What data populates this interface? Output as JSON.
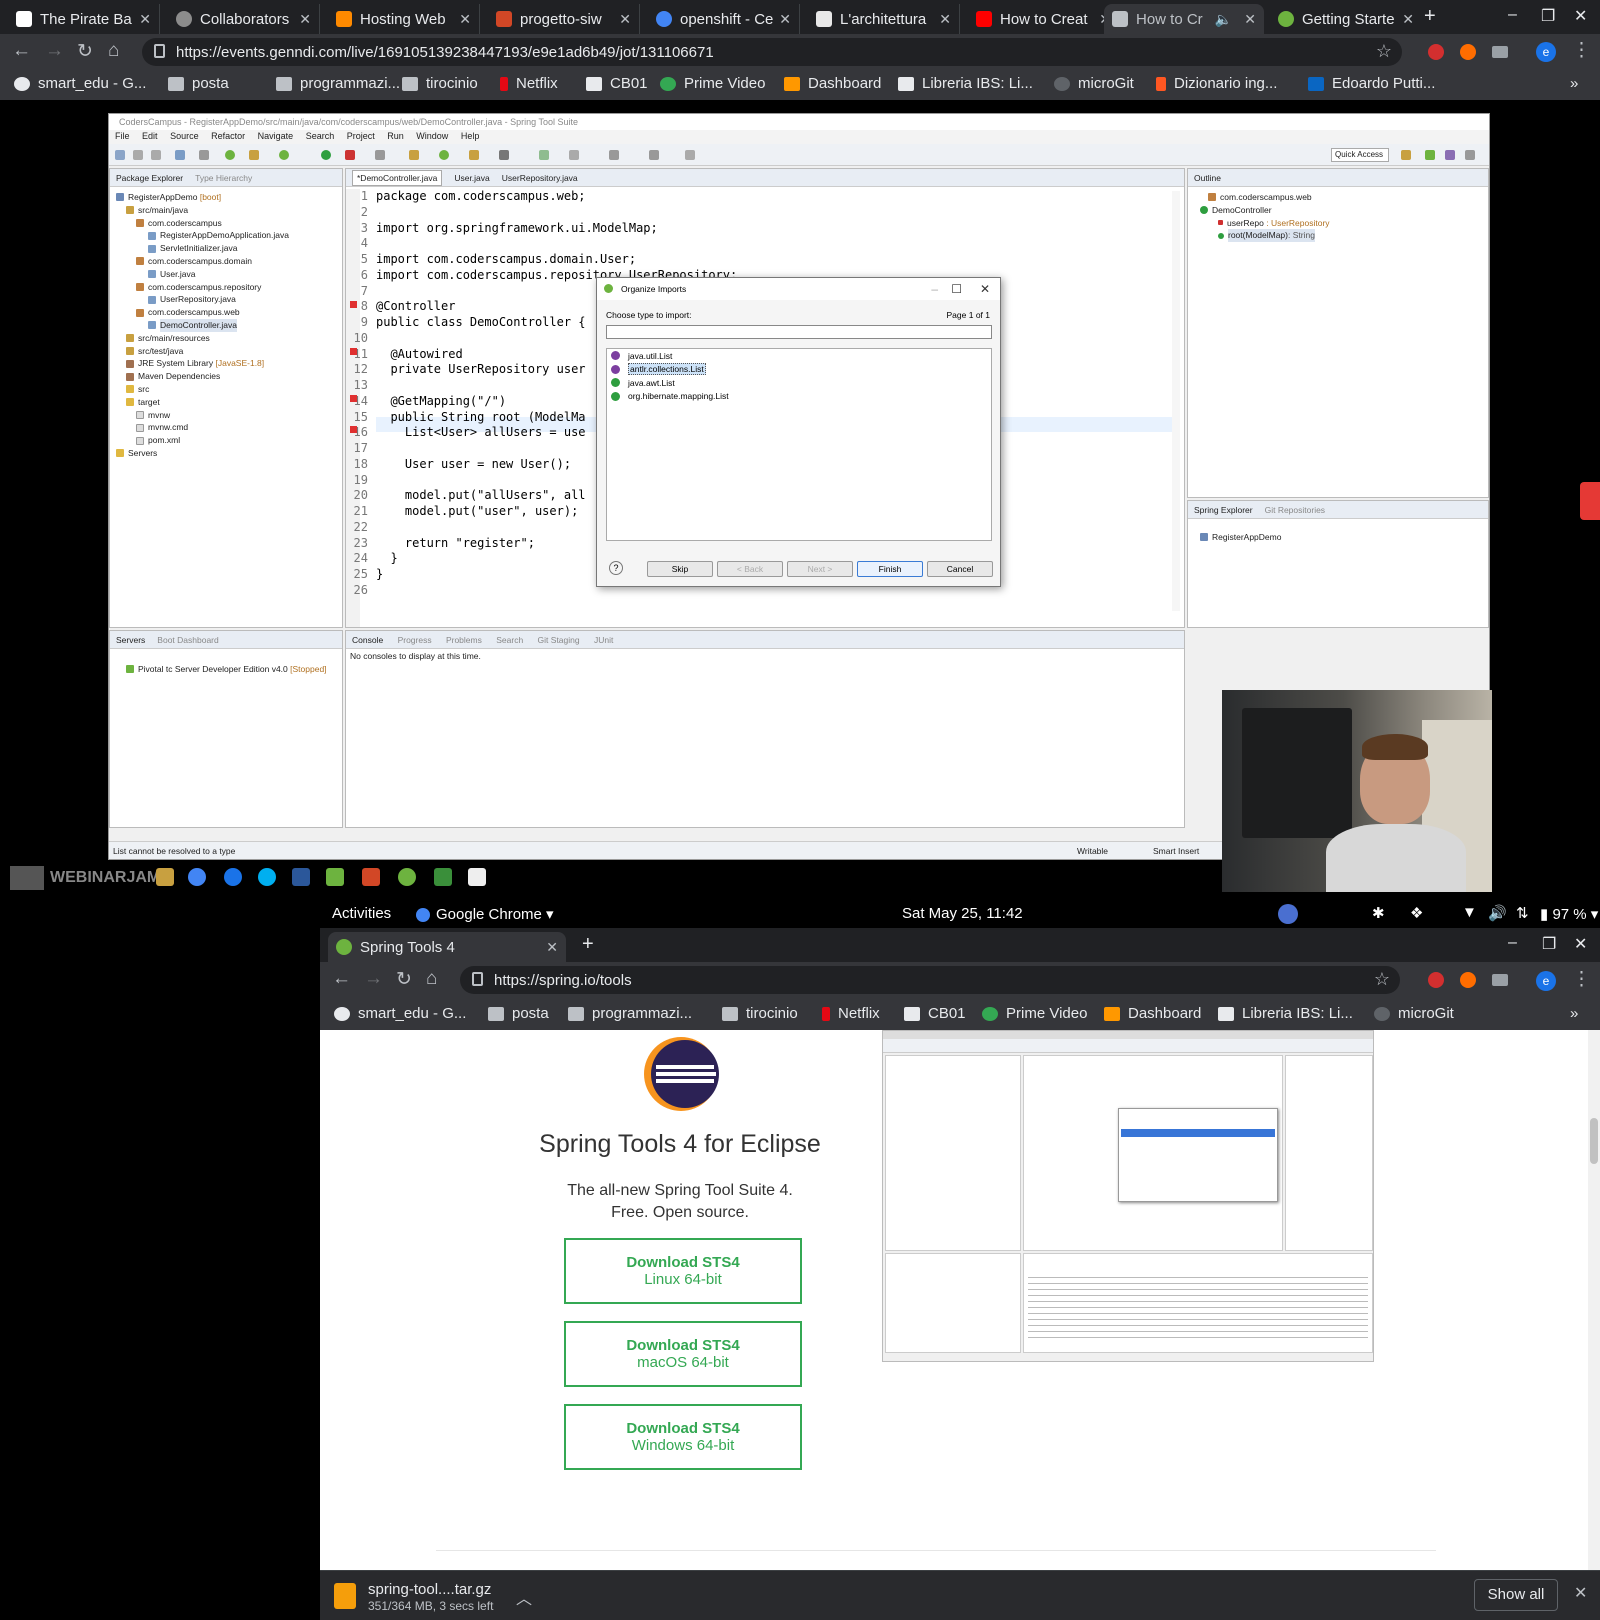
{
  "top_browser": {
    "tabs": [
      {
        "title": "The Pirate Ba",
        "color": "#ffffff"
      },
      {
        "title": "Collaborators",
        "color": "#8c8c8c"
      },
      {
        "title": "Hosting Web",
        "color": "#ff8a00"
      },
      {
        "title": "progetto-siw",
        "color": "#d24726"
      },
      {
        "title": "openshift - Ce",
        "color": "#4285f4"
      },
      {
        "title": "L'architettura",
        "color": "#e8e8e8"
      },
      {
        "title": "How to Creat",
        "color": "#ff0000"
      },
      {
        "title": "How to Cr",
        "color": "#bdc1c6"
      },
      {
        "title": "Getting Starte",
        "color": "#6db33f"
      }
    ],
    "new_tab": "+",
    "url": "https://events.genndi.com/live/169105139238447193/e9e1ad6b49/jot/131106671",
    "avatar_letter": "e"
  },
  "bookmarks": [
    {
      "label": "smart_edu - G...",
      "icon": "github-icon"
    },
    {
      "label": "posta",
      "icon": "folder-icon"
    },
    {
      "label": "programmazi...",
      "icon": "folder-icon"
    },
    {
      "label": "tirocinio",
      "icon": "folder-icon"
    },
    {
      "label": "Netflix",
      "icon": "netflix-icon"
    },
    {
      "label": "CB01",
      "icon": "cb01-icon"
    },
    {
      "label": "Prime Video",
      "icon": "play-icon"
    },
    {
      "label": "Dashboard",
      "icon": "dashboard-icon"
    },
    {
      "label": "Libreria IBS: Li...",
      "icon": "ibs-icon"
    },
    {
      "label": "microGit",
      "icon": "github-icon"
    },
    {
      "label": "Dizionario ing...",
      "icon": "r-icon"
    },
    {
      "label": "Edoardo Putti...",
      "icon": "linkedin-icon"
    }
  ],
  "more_bookmarks": "»",
  "sts": {
    "title": "CodersCampus - RegisterAppDemo/src/main/java/com/coderscampus/web/DemoController.java - Spring Tool Suite",
    "menu": [
      "File",
      "Edit",
      "Source",
      "Refactor",
      "Navigate",
      "Search",
      "Project",
      "Run",
      "Window",
      "Help"
    ],
    "quick_access": "Quick Access",
    "package_explorer_tabs": [
      "Package Explorer",
      "Type Hierarchy"
    ],
    "tree": [
      {
        "label": "RegisterAppDemo",
        "suffix": "[boot]",
        "indent": 0
      },
      {
        "label": "src/main/java",
        "suffix": "",
        "indent": 1
      },
      {
        "label": "com.coderscampus",
        "suffix": "",
        "indent": 2
      },
      {
        "label": "RegisterAppDemoApplication.java",
        "suffix": "",
        "indent": 3
      },
      {
        "label": "ServletInitializer.java",
        "suffix": "",
        "indent": 3
      },
      {
        "label": "com.coderscampus.domain",
        "suffix": "",
        "indent": 2
      },
      {
        "label": "User.java",
        "suffix": "",
        "indent": 3
      },
      {
        "label": "com.coderscampus.repository",
        "suffix": "",
        "indent": 2
      },
      {
        "label": "UserRepository.java",
        "suffix": "",
        "indent": 3
      },
      {
        "label": "com.coderscampus.web",
        "suffix": "",
        "indent": 2
      },
      {
        "label": "DemoController.java",
        "suffix": "",
        "indent": 3
      },
      {
        "label": "src/main/resources",
        "suffix": "",
        "indent": 1
      },
      {
        "label": "src/test/java",
        "suffix": "",
        "indent": 1
      },
      {
        "label": "JRE System Library",
        "suffix": "[JavaSE-1.8]",
        "indent": 1
      },
      {
        "label": "Maven Dependencies",
        "suffix": "",
        "indent": 1
      },
      {
        "label": "src",
        "suffix": "",
        "indent": 1
      },
      {
        "label": "target",
        "suffix": "",
        "indent": 1
      },
      {
        "label": "mvnw",
        "suffix": "",
        "indent": 1
      },
      {
        "label": "mvnw.cmd",
        "suffix": "",
        "indent": 1
      },
      {
        "label": "pom.xml",
        "suffix": "",
        "indent": 1
      },
      {
        "label": "Servers",
        "suffix": "",
        "indent": 0
      }
    ],
    "editor_tabs": [
      "*DemoController.java",
      "User.java",
      "UserRepository.java"
    ],
    "code_lines": [
      "package com.coderscampus.web;",
      "",
      "import org.springframework.ui.ModelMap;",
      "",
      "import com.coderscampus.domain.User;",
      "import com.coderscampus.repository.UserRepository;",
      "",
      "@Controller",
      "public class DemoController {",
      "",
      "  @Autowired",
      "  private UserRepository user",
      "",
      "  @GetMapping(\"/\")",
      "  public String root (ModelMa",
      "    List<User> allUsers = use",
      "",
      "    User user = new User();",
      "",
      "    model.put(\"allUsers\", all",
      "    model.put(\"user\", user);",
      "",
      "    return \"register\";",
      "  }",
      "}",
      ""
    ],
    "outline_title": "Outline",
    "outline": [
      {
        "label": "com.coderscampus.web",
        "suffix": ""
      },
      {
        "label": "DemoController",
        "suffix": ""
      },
      {
        "label": "userRepo",
        "suffix": ": UserRepository"
      },
      {
        "label": "root(ModelMap)",
        "suffix": ": String"
      }
    ],
    "spring_explorer_tabs": [
      "Spring Explorer",
      "Git Repositories"
    ],
    "spring_explorer_item": "RegisterAppDemo",
    "servers_tabs": [
      "Servers",
      "Boot Dashboard"
    ],
    "server_item": "Pivotal tc Server Developer Edition v4.0",
    "server_status": "[Stopped]",
    "console_tabs": [
      "Console",
      "Progress",
      "Problems",
      "Search",
      "Git Staging",
      "JUnit"
    ],
    "console_text": "No consoles to display at this time.",
    "status_msg": "List cannot be resolved to a type",
    "status_writable": "Writable",
    "status_insert": "Smart Insert"
  },
  "dialog": {
    "title": "Organize Imports",
    "prompt": "Choose type to import:",
    "page": "Page 1 of 1",
    "filter_value": "",
    "options": [
      {
        "label": "java.util.List",
        "kind": "interface",
        "selected": false
      },
      {
        "label": "antlr.collections.List",
        "kind": "interface",
        "selected": true
      },
      {
        "label": "java.awt.List",
        "kind": "class",
        "selected": false
      },
      {
        "label": "org.hibernate.mapping.List",
        "kind": "class",
        "selected": false
      }
    ],
    "buttons": {
      "skip": "Skip",
      "back": "< Back",
      "next": "Next >",
      "finish": "Finish",
      "cancel": "Cancel"
    },
    "help": "?"
  },
  "watermark": "WEBINARJAM",
  "gnome": {
    "activities": "Activities",
    "app": "Google Chrome",
    "clock": "Sat May 25, 11:42",
    "battery": "97 %"
  },
  "browser2": {
    "tab_title": "Spring Tools 4",
    "new_tab": "+",
    "url": "https://spring.io/tools",
    "avatar_letter": "e",
    "bookmarks": [
      "smart_edu - G...",
      "posta",
      "programmazi...",
      "tirocinio",
      "Netflix",
      "CB01",
      "Prime Video",
      "Dashboard",
      "Libreria IBS: Li...",
      "microGit"
    ]
  },
  "page": {
    "heading": "Spring Tools 4 for Eclipse",
    "tagline1": "The all-new Spring Tool Suite 4.",
    "tagline2": "Free. Open source.",
    "downloads": [
      {
        "label": "Download STS4",
        "platform": "Linux 64-bit"
      },
      {
        "label": "Download STS4",
        "platform": "macOS 64-bit"
      },
      {
        "label": "Download STS4",
        "platform": "Windows 64-bit"
      }
    ]
  },
  "download_shelf": {
    "filename": "spring-tool....tar.gz",
    "progress": "351/364 MB, 3 secs left",
    "show_all": "Show all"
  }
}
